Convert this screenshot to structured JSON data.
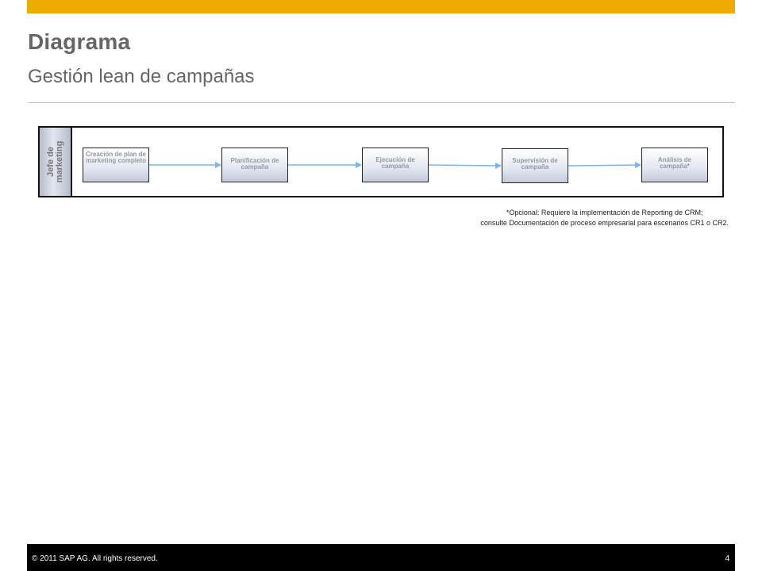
{
  "header": {
    "title": "Diagrama",
    "subtitle": "Gestión lean de campañas",
    "accent_color": "#f0ab00"
  },
  "diagram": {
    "lane_label": [
      "Jefe de",
      "marketing"
    ],
    "steps": [
      {
        "label": "Creación de plan de marketing completo"
      },
      {
        "label": "Planificación de campaña"
      },
      {
        "label": "Ejecución de campaña"
      },
      {
        "label": "Supervisión de campaña"
      },
      {
        "label": "Análisis de campaña*"
      }
    ],
    "arrow_color": "#7fb3e8"
  },
  "footnote": {
    "line1": "*Opcional: Requiere la implementación de Reporting de CRM;",
    "line2": "consulte Documentación de proceso empresarial para escenarios CR1 o CR2."
  },
  "footer": {
    "copyright": "© 2011 SAP AG. All rights reserved.",
    "page_number": "4"
  }
}
